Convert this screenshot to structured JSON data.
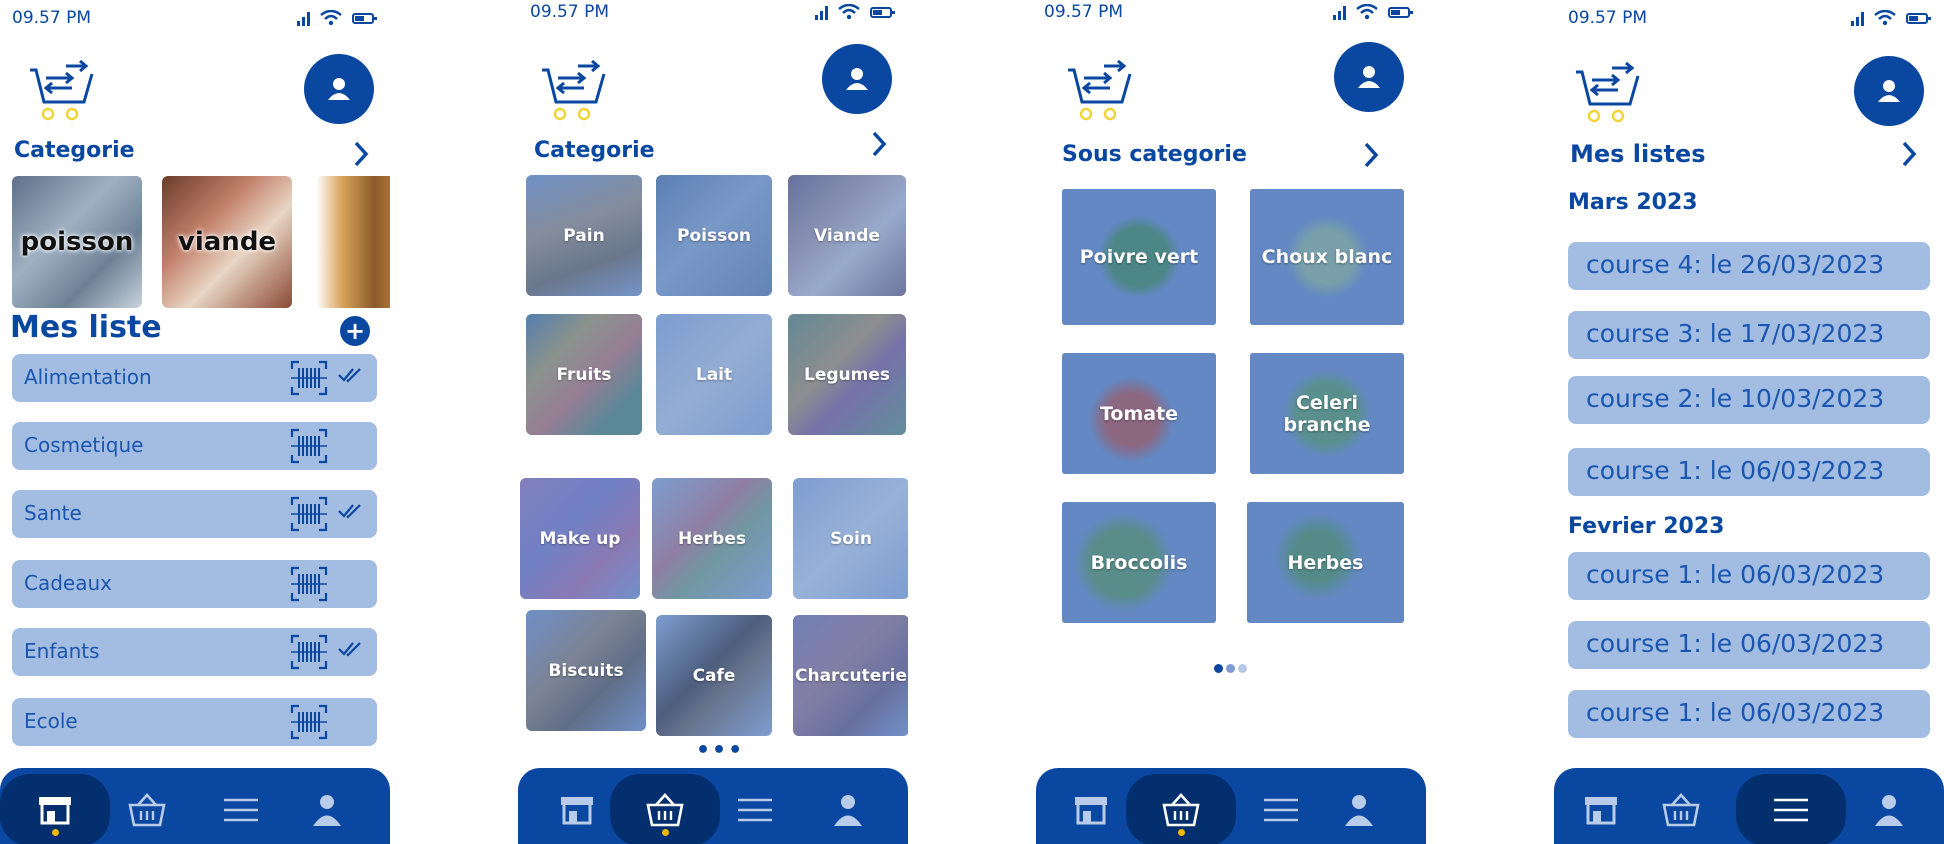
{
  "status": {
    "time": "09.57 PM"
  },
  "screen1": {
    "categorie_title": "Categorie",
    "categories": [
      {
        "label": "poisson"
      },
      {
        "label": "viande"
      },
      {
        "label": ""
      }
    ],
    "mes_liste_title": "Mes liste",
    "add_symbol": "+",
    "lists": [
      {
        "label": "Alimentation",
        "checked": true
      },
      {
        "label": "Cosmetique",
        "checked": false
      },
      {
        "label": "Sante",
        "checked": true
      },
      {
        "label": "Cadeaux",
        "checked": false
      },
      {
        "label": "Enfants",
        "checked": true
      },
      {
        "label": "Ecole",
        "checked": false
      }
    ]
  },
  "screen2": {
    "categorie_title": "Categorie",
    "tiles": [
      {
        "label": "Pain"
      },
      {
        "label": "Poisson"
      },
      {
        "label": "Viande"
      },
      {
        "label": "Fruits"
      },
      {
        "label": "Lait"
      },
      {
        "label": "Legumes"
      },
      {
        "label": "Make up"
      },
      {
        "label": "Herbes"
      },
      {
        "label": "Soin"
      },
      {
        "label": "Biscuits"
      },
      {
        "label": "Cafe"
      },
      {
        "label": "Charcuterie"
      }
    ],
    "more": "•••"
  },
  "screen3": {
    "title": "Sous categorie",
    "tiles": [
      {
        "label": "Poivre vert"
      },
      {
        "label": "Choux blanc"
      },
      {
        "label": "Tomate"
      },
      {
        "label": "Celeri branche"
      },
      {
        "label": "Broccolis"
      },
      {
        "label": "Herbes"
      }
    ],
    "pager": {
      "count": 3,
      "active": 0
    }
  },
  "screen4": {
    "title": "Mes listes",
    "groups": [
      {
        "month": "Mars 2023",
        "items": [
          "course 4: le 26/03/2023",
          "course 3: le 17/03/2023",
          "course 2: le 10/03/2023",
          "course 1: le 06/03/2023"
        ]
      },
      {
        "month": "Fevrier 2023",
        "items": [
          "course 1: le 06/03/2023",
          "course 1: le 06/03/2023",
          "course 1: le 06/03/2023"
        ]
      }
    ]
  },
  "nav": {
    "items": [
      "store-icon",
      "basket-icon",
      "menu-icon",
      "user-icon"
    ],
    "active_by_screen": [
      0,
      1,
      1,
      2
    ]
  },
  "colors": {
    "primary": "#0a47a0",
    "nav_active": "#042f6e",
    "row_bg": "#a3bde2",
    "accent_dot": "#f5b800",
    "logo_wheels": "#f2d43a"
  }
}
